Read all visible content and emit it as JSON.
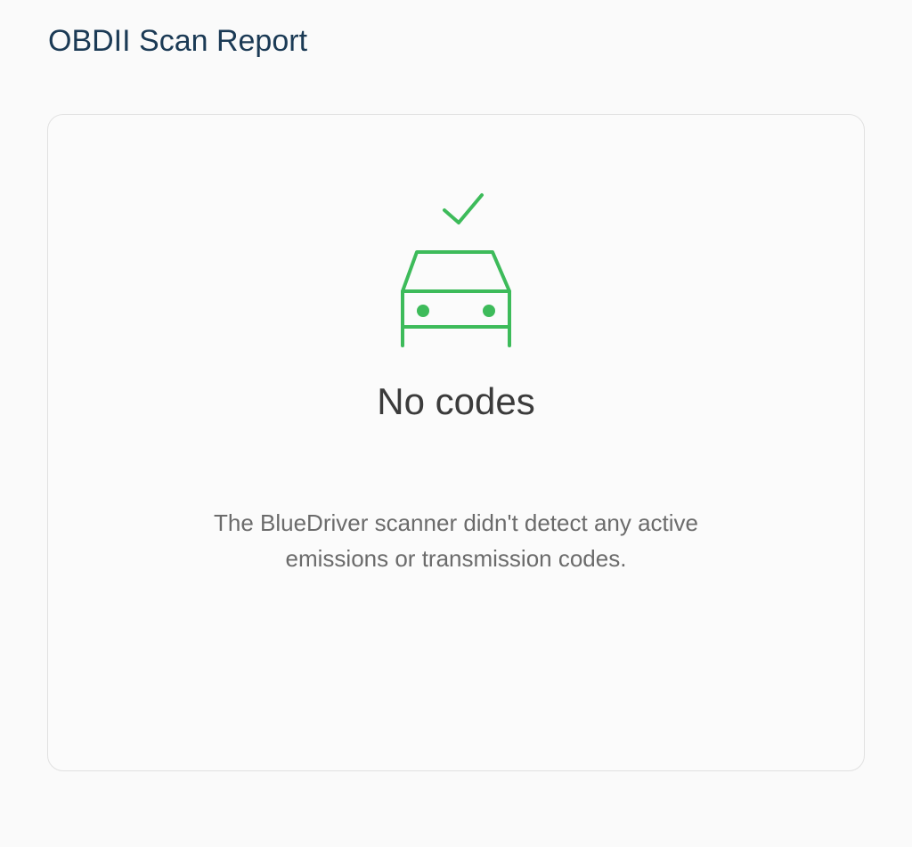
{
  "header": {
    "title": "OBDII Scan Report"
  },
  "report": {
    "icon": "car-check-icon",
    "status_title": "No codes",
    "status_message": "The BlueDriver scanner didn't detect any active emissions or transmission codes."
  },
  "colors": {
    "accent_green": "#3dbb5a",
    "title_blue": "#1b3a55",
    "text_dark": "#3b3b3b",
    "text_muted": "#6b6b6b"
  }
}
